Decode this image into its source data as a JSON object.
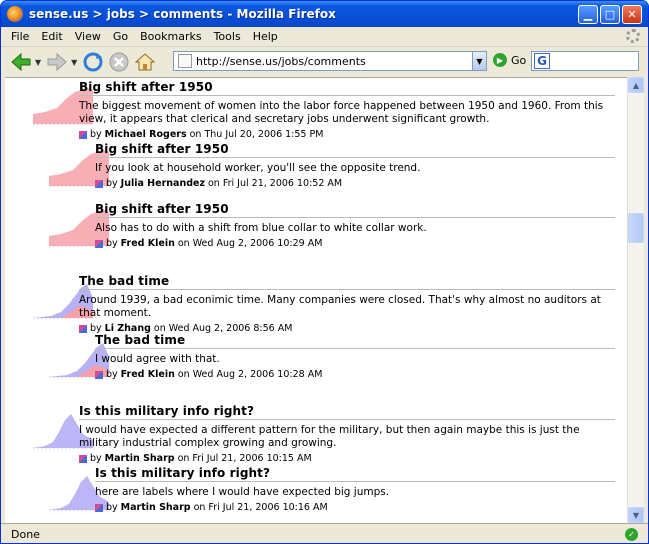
{
  "window": {
    "title": "sense.us > jobs > comments - Mozilla Firefox"
  },
  "menu": [
    "File",
    "Edit",
    "View",
    "Go",
    "Bookmarks",
    "Tools",
    "Help"
  ],
  "toolbar": {
    "url": "http://sense.us/jobs/comments",
    "go_label": "Go"
  },
  "comments": [
    {
      "title": "Big shift after 1950",
      "text": "The biggest movement of women into the labor force happened between 1950 and 1960. From this view, it appears that clerical and secretary jobs underwent significant growth.",
      "by": "by",
      "author": "Michael Rogers",
      "on": "on Thu Jul 20, 2006 1:55 PM",
      "color": "pink"
    },
    {
      "title": "Big shift after 1950",
      "text": "If you look at household worker, you'll see the opposite trend.",
      "by": "by",
      "author": "Julia Hernandez",
      "on": "on Fri Jul 21, 2006 10:52 AM",
      "color": "pink"
    },
    {
      "title": "Big shift after 1950",
      "text": "Also has to do with a shift from blue collar to white collar work.",
      "by": "by",
      "author": "Fred Klein",
      "on": "on Wed Aug 2, 2006 10:29 AM",
      "color": "pink"
    },
    {
      "title": "The bad time",
      "text": "Around 1939, a bad econimic time. Many companies were closed. That's why almost no auditors at that moment.",
      "by": "by",
      "author": "Li Zhang",
      "on": "on Wed Aug 2, 2006 8:56 AM",
      "color": "mixed"
    },
    {
      "title": "The bad time",
      "text": "I would agree with that.",
      "by": "by",
      "author": "Fred Klein",
      "on": "on Wed Aug 2, 2006 10:28 AM",
      "color": "mixed"
    },
    {
      "title": "Is this military info right?",
      "text": "I would have expected a different pattern for the military, but then again maybe this is just the military industrial complex growing and growing.",
      "by": "by",
      "author": "Martin Sharp",
      "on": "on Fri Jul 21, 2006 10:15 AM",
      "color": "blue"
    },
    {
      "title": "Is this military info right?",
      "text": "here are labels where I would have expected big jumps.",
      "by": "by",
      "author": "Martin Sharp",
      "on": "on Fri Jul 21, 2006 10:16 AM",
      "color": "blue"
    }
  ],
  "status": {
    "text": "Done"
  }
}
